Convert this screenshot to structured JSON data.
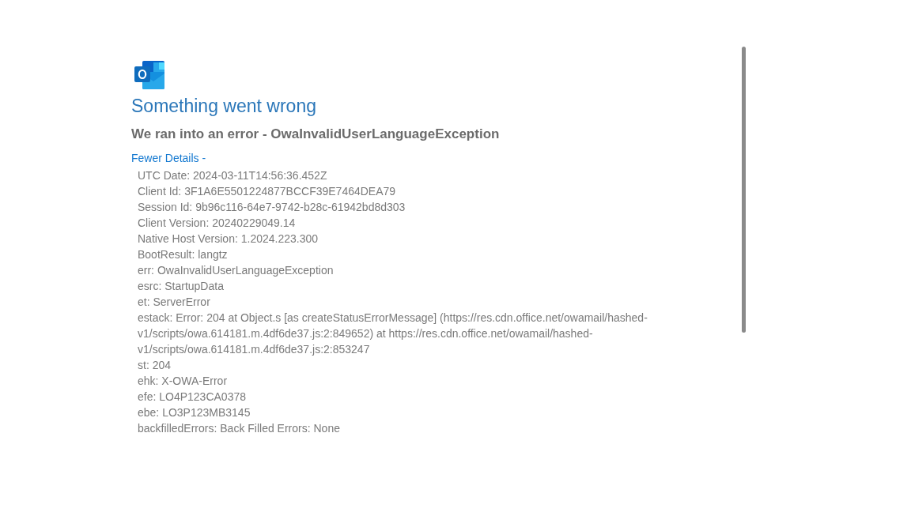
{
  "title": "Something went wrong",
  "subtitle": "We ran into an error - OwaInvalidUserLanguageException",
  "details_toggle": {
    "label": "Fewer Details -"
  },
  "details": [
    "UTC Date: 2024-03-11T14:56:36.452Z",
    "Client Id: 3F1A6E5501224877BCCF39E7464DEA79",
    "Session Id: 9b96c116-64e7-9742-b28c-61942bd8d303",
    "Client Version: 20240229049.14",
    "Native Host Version: 1.2024.223.300",
    "BootResult: langtz",
    "err: OwaInvalidUserLanguageException",
    "esrc: StartupData",
    "et: ServerError",
    "estack: Error: 204 at Object.s [as createStatusErrorMessage] (https://res.cdn.office.net/owamail/hashed-v1/scripts/owa.614181.m.4df6de37.js:2:849652) at https://res.cdn.office.net/owamail/hashed-v1/scripts/owa.614181.m.4df6de37.js:2:853247",
    "st: 204",
    "ehk: X-OWA-Error",
    "efe: LO4P123CA0378",
    "ebe: LO3P123MB3145",
    "backfilledErrors: Back Filled Errors: None"
  ]
}
